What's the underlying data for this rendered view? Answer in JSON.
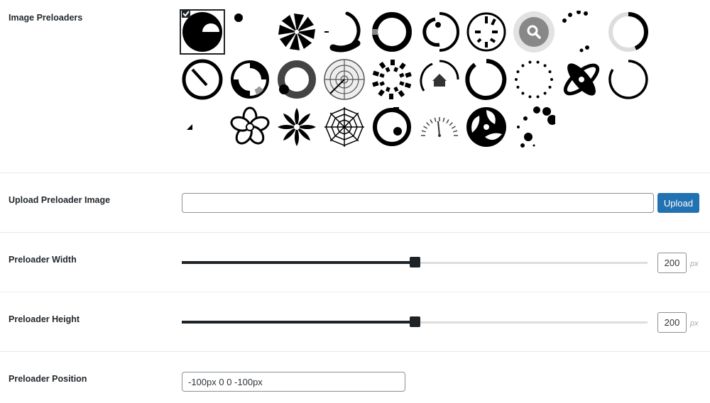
{
  "image_preloaders": {
    "label": "Image Preloaders",
    "items": [
      {
        "icon": "half-moon-circle-icon",
        "selected": true
      },
      {
        "icon": "small-dot-icon"
      },
      {
        "icon": "pinwheel-icon"
      },
      {
        "icon": "swirl-spinner-icon"
      },
      {
        "icon": "thick-ring-icon"
      },
      {
        "icon": "partial-arcs-icon"
      },
      {
        "icon": "clock-segments-icon"
      },
      {
        "icon": "search-bubble-icon"
      },
      {
        "icon": "dot-arc-icon"
      },
      {
        "icon": "gradient-ring-icon"
      },
      {
        "icon": "gauge-needle-icon"
      },
      {
        "icon": "split-ring-icon"
      },
      {
        "icon": "ball-in-ring-icon"
      },
      {
        "icon": "radar-icon"
      },
      {
        "icon": "segmented-dashes-icon"
      },
      {
        "icon": "home-arc-icon"
      },
      {
        "icon": "open-ring-icon"
      },
      {
        "icon": "dotted-circle-icon"
      },
      {
        "icon": "atom-petals-icon"
      },
      {
        "icon": "thin-ring-icon"
      },
      {
        "icon": "small-triangle-icon"
      },
      {
        "icon": "flower-outline-icon"
      },
      {
        "icon": "flower-petals-icon"
      },
      {
        "icon": "spider-web-icon"
      },
      {
        "icon": "eye-ring-icon"
      },
      {
        "icon": "speedometer-icon"
      },
      {
        "icon": "yin-swirl-icon"
      },
      {
        "icon": "growing-dots-icon"
      }
    ]
  },
  "upload": {
    "label": "Upload Preloader Image",
    "value": "",
    "button_label": "Upload"
  },
  "width": {
    "label": "Preloader Width",
    "value": "200",
    "unit": "px",
    "level": 0.5
  },
  "height": {
    "label": "Preloader Height",
    "value": "200",
    "unit": "px",
    "level": 0.5
  },
  "position": {
    "label": "Preloader Position",
    "value": "-100px 0 0 -100px"
  },
  "colors": {
    "accent": "#2271b1",
    "dark": "#1d2327"
  }
}
